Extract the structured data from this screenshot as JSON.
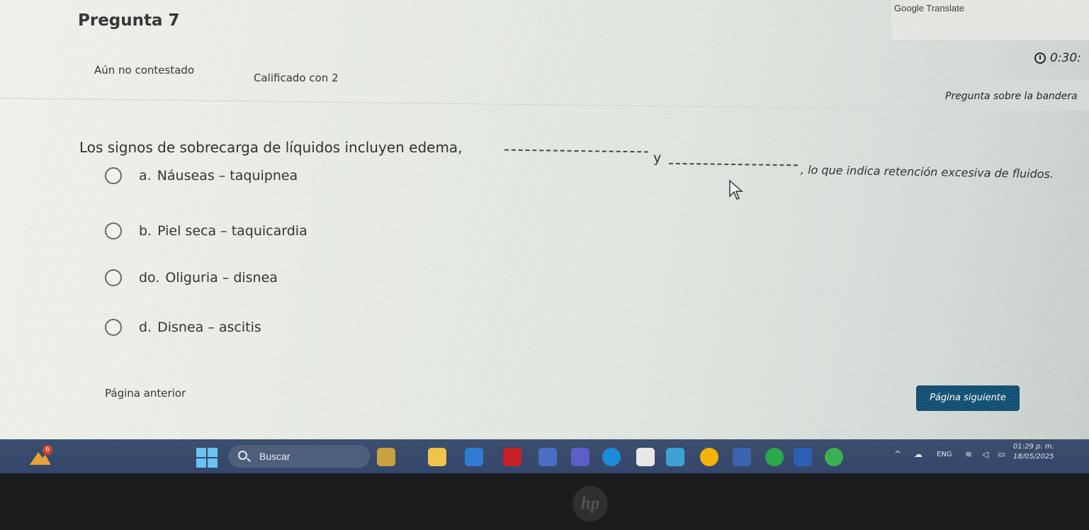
{
  "extension": {
    "label": "Google Translate"
  },
  "question": {
    "title": "Pregunta 7",
    "status": "Aún no contestado",
    "grade": "Calificado con 2",
    "timer": "0:30:",
    "flag_label": "Pregunta sobre la bandera",
    "text_start": "Los signos de sobrecarga de líquidos incluyen edema,",
    "connector": "y",
    "text_end": ", lo que indica retención excesiva de fluidos."
  },
  "options": [
    {
      "letter": "a.",
      "text": "Náuseas – taquipnea"
    },
    {
      "letter": "b.",
      "text": "Piel seca – taquicardia"
    },
    {
      "letter": "do.",
      "text": "Oliguria – disnea"
    },
    {
      "letter": "d.",
      "text": "Disnea – ascitis"
    }
  ],
  "navigation": {
    "prev_label": "Página anterior",
    "next_label": "Página siguiente"
  },
  "taskbar": {
    "weather_badge": "6",
    "search_label": "Buscar",
    "language": "ENG",
    "time": "01:29 p. m.",
    "date": "18/05/2025",
    "apps": [
      "file-explorer-icon",
      "teams-icon",
      "netflix-icon",
      "vs-code-icon",
      "edge-icon",
      "chrome-icon",
      "word-icon",
      "store-icon"
    ]
  },
  "device": {
    "brand": "hp"
  },
  "colors": {
    "primary_button": "#0f4f73",
    "taskbar": "#3c4f6e"
  }
}
